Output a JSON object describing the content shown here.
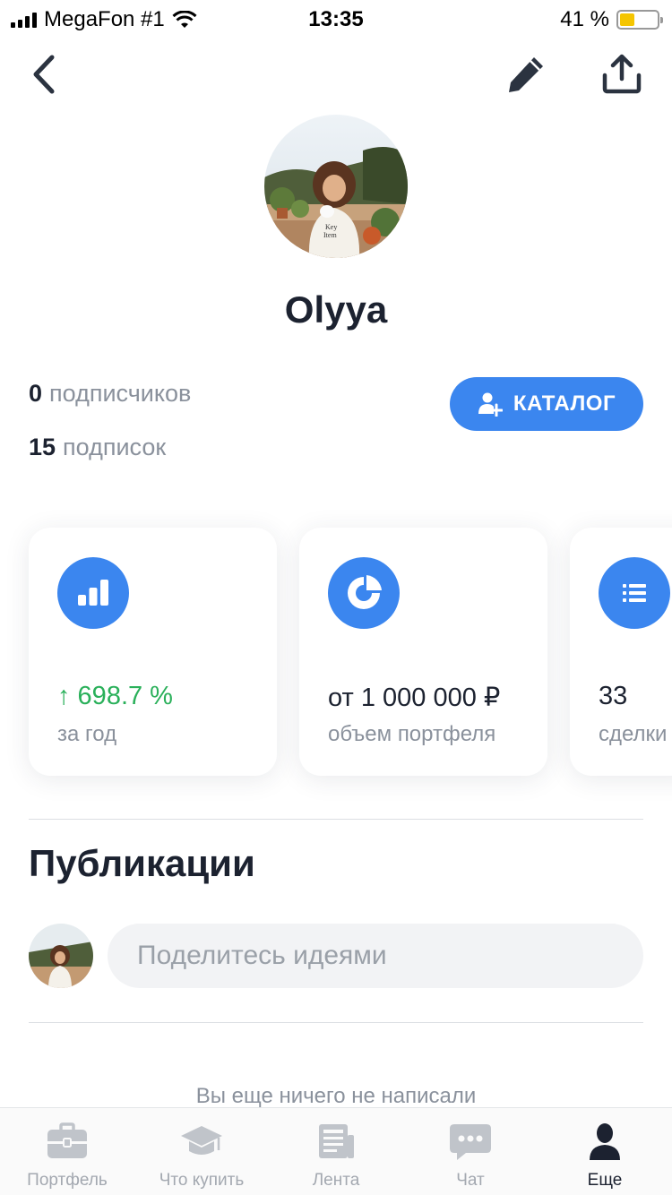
{
  "status_bar": {
    "carrier": "MegaFon #1",
    "time": "13:35",
    "battery": "41 %",
    "battery_level": 0.41,
    "icons": [
      "signal-icon",
      "wifi-icon",
      "battery-icon"
    ]
  },
  "nav": {
    "icons": [
      "chevron-left-icon",
      "pencil-icon",
      "share-icon"
    ]
  },
  "profile": {
    "name": "Olyya",
    "followers_count": "0",
    "followers_label": "подписчиков",
    "following_count": "15",
    "following_label": "подписок",
    "catalog_button": "КАТАЛОГ"
  },
  "stats": [
    {
      "icon": "bar-chart-icon",
      "value": "↑ 698.7 %",
      "label": "за год",
      "value_color": "#2ab05a"
    },
    {
      "icon": "pie-chart-icon",
      "value": "от 1 000 000 ₽",
      "label": "объем портфеля"
    },
    {
      "icon": "list-icon",
      "value": "33",
      "label": "сделки"
    }
  ],
  "publications": {
    "title": "Публикации",
    "input_placeholder": "Поделитесь идеями",
    "empty_text": "Вы еще ничего не написали"
  },
  "tabbar": {
    "items": [
      {
        "label": "Портфель",
        "icon": "briefcase-icon",
        "active": false
      },
      {
        "label": "Что купить",
        "icon": "graduation-cap-icon",
        "active": false
      },
      {
        "label": "Лента",
        "icon": "newspaper-icon",
        "active": false
      },
      {
        "label": "Чат",
        "icon": "chat-bubble-icon",
        "active": false
      },
      {
        "label": "Еще",
        "icon": "person-icon",
        "active": true
      }
    ]
  },
  "colors": {
    "accent": "#3b86ef",
    "positive": "#2ab05a",
    "text_primary": "#1c2230",
    "text_secondary": "#8a919c"
  }
}
